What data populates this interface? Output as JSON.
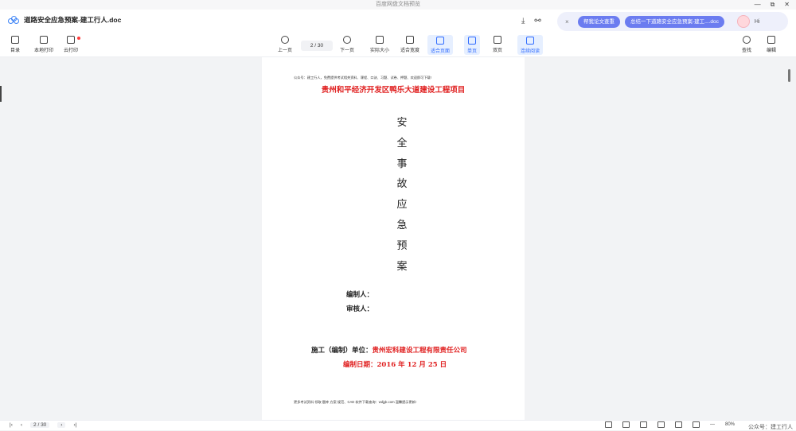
{
  "window": {
    "title": "百度网盘文档预览",
    "controls": [
      "—",
      "⧉",
      "✕"
    ]
  },
  "tab": {
    "filename": "道路安全应急预案-建工行人.doc"
  },
  "ai": {
    "chip1": "帮我论文查重",
    "chip2": "总结一下道路安全应急预案-建工....doc",
    "greeting": "Hi"
  },
  "toolbar": {
    "catalog": "目录",
    "local_print": "本地打印",
    "cloud_print": "云打印",
    "prev": "上一页",
    "page_indicator": "2 / 30",
    "next": "下一页",
    "actual_size": "实际大小",
    "fit_width": "适合宽度",
    "fit_page": "适合页面",
    "single": "单页",
    "double": "双页",
    "continuous": "连续阅读",
    "find": "查找",
    "edit": "编辑"
  },
  "document": {
    "header_note": "公众号：建工行人，免费提供考试相关资料、课程、口诀、习题、试卷、押题、欢迎即可下载!",
    "project": "贵州和平经济开发区鸭乐大道建设工程项目",
    "title_chars": [
      "安",
      "全",
      "事",
      "故",
      "应",
      "急",
      "预",
      "案"
    ],
    "compiler_label": "编制人：",
    "reviewer_label": "审核人：",
    "unit_label": "施工（编制）单位：",
    "unit_value": "贵州宏科建设工程有限责任公司",
    "date_line": "编制日期：2016 年 12 月 25 日",
    "footer_note": "更多考试资料 领取 题库 方案 规范、CAD 软件下载查询：wdjgk.com 温馨提示更新!"
  },
  "statusbar": {
    "page_indicator": "2 / 30",
    "zoom": "80%",
    "watermark": "公众号：建工行人"
  }
}
